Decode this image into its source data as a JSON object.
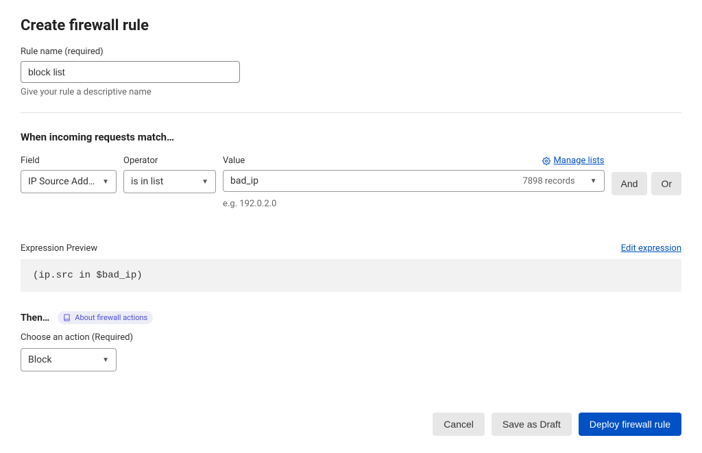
{
  "page_title": "Create firewall rule",
  "rule_name": {
    "label": "Rule name (required)",
    "value": "block list",
    "helper": "Give your rule a descriptive name"
  },
  "match": {
    "heading": "When incoming requests match…",
    "field": {
      "label": "Field",
      "value": "IP Source Address"
    },
    "operator": {
      "label": "Operator",
      "value": "is in list"
    },
    "value": {
      "label": "Value",
      "selected": "bad_ip",
      "records": "7898 records",
      "example": "e.g. 192.0.2.0",
      "manage_label": "Manage lists"
    },
    "and_label": "And",
    "or_label": "Or"
  },
  "preview": {
    "label": "Expression Preview",
    "edit_label": "Edit expression",
    "expression": "(ip.src in $bad_ip)"
  },
  "then": {
    "label": "Then…",
    "about_label": "About firewall actions",
    "action_label": "Choose an action (Required)",
    "action_value": "Block"
  },
  "footer": {
    "cancel": "Cancel",
    "save_draft": "Save as Draft",
    "deploy": "Deploy firewall rule"
  }
}
